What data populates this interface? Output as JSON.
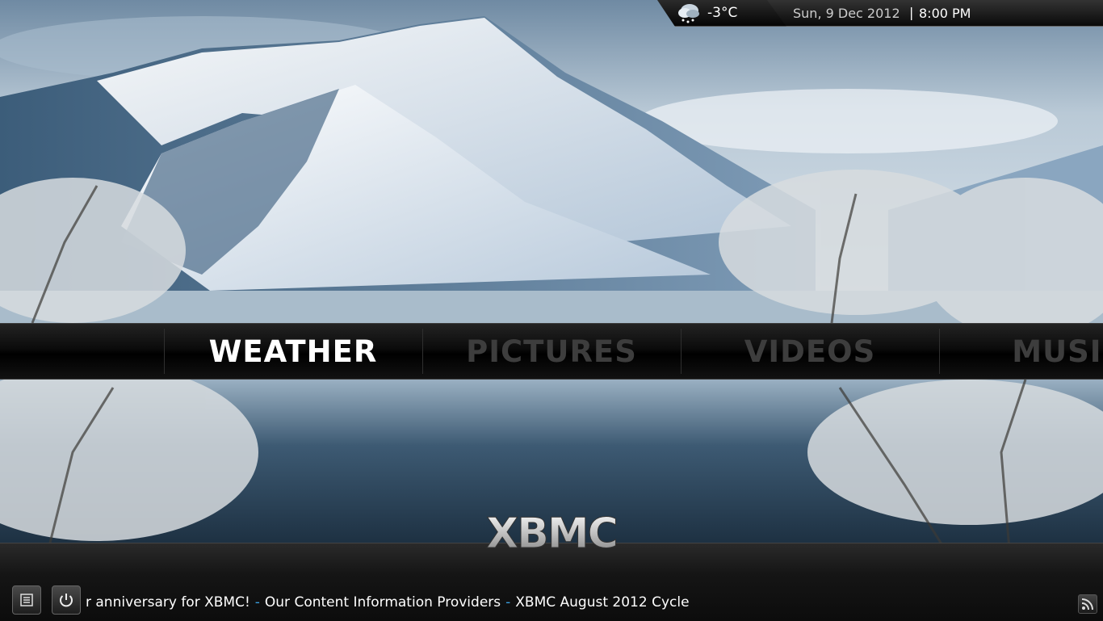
{
  "status_bar": {
    "temperature": "-3°C",
    "date": "Sun, 9 Dec 2012",
    "separator": "|",
    "time": "8:00 PM",
    "weather_icon": "cloud-snow-icon"
  },
  "menu": {
    "items": [
      {
        "label": "WEATHER",
        "active": true
      },
      {
        "label": "PICTURES",
        "active": false
      },
      {
        "label": "VIDEOS",
        "active": false
      },
      {
        "label": "MUSIC",
        "active": false
      }
    ]
  },
  "logo_text": "XBMC",
  "ticker": {
    "items": [
      "r anniversary for XBMC!",
      "Our Content Information Providers",
      "XBMC August 2012 Cycle"
    ],
    "separator": "-"
  },
  "buttons": {
    "favourites_icon": "list-icon",
    "power_icon": "power-icon",
    "rss_icon": "rss-icon"
  },
  "colors": {
    "accent": "#3aa0e0",
    "active_text": "#ffffff",
    "inactive_text": "#3d3d3d"
  }
}
